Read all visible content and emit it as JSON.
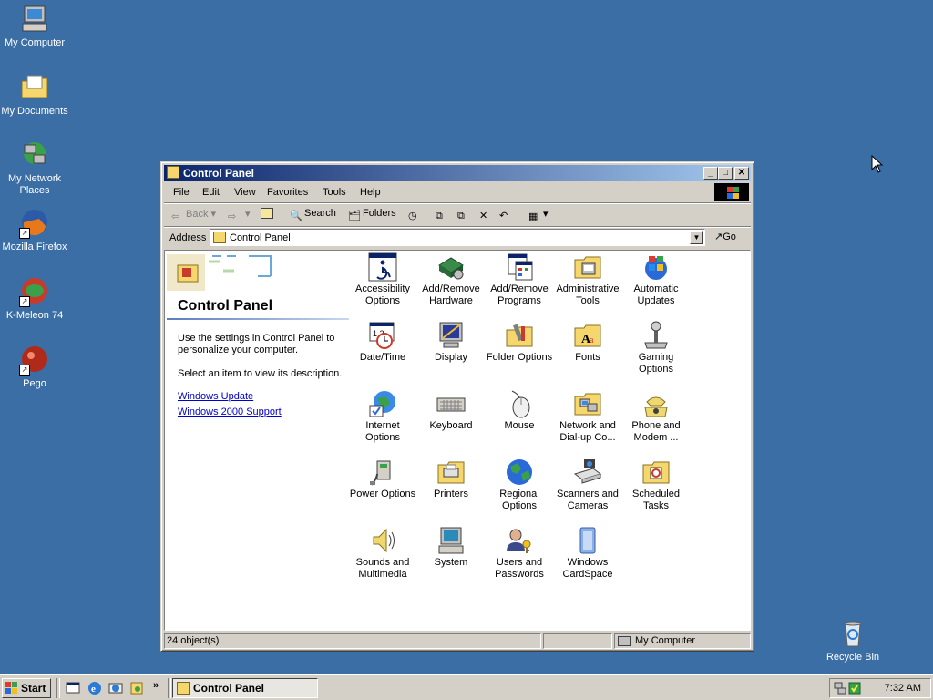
{
  "desktop": {
    "icons": [
      {
        "label": "My Computer",
        "icon": "my-computer-icon"
      },
      {
        "label": "My Documents",
        "icon": "my-documents-icon"
      },
      {
        "label": "My Network Places",
        "icon": "network-places-icon"
      },
      {
        "label": "Mozilla Firefox",
        "icon": "firefox-icon"
      },
      {
        "label": "K-Meleon 74",
        "icon": "k-meleon-icon"
      },
      {
        "label": "Pego",
        "icon": "pego-icon"
      },
      {
        "label": "Recycle Bin",
        "icon": "recycle-bin-icon"
      }
    ],
    "background": "#3a6ea5"
  },
  "window": {
    "title": "Control Panel",
    "menu": [
      "File",
      "Edit",
      "View",
      "Favorites",
      "Tools",
      "Help"
    ],
    "toolbar": {
      "back": "Back",
      "search": "Search",
      "folders": "Folders"
    },
    "address": {
      "label": "Address",
      "value": "Control Panel",
      "go": "Go"
    },
    "sidebar": {
      "title": "Control Panel",
      "description": "Use the settings in Control Panel to personalize your computer.",
      "hint": "Select an item to view its description.",
      "links": [
        "Windows Update",
        "Windows 2000 Support"
      ]
    },
    "items": [
      {
        "label": "Accessibility Options",
        "icon": "accessibility-icon"
      },
      {
        "label": "Add/Remove Hardware",
        "icon": "add-hardware-icon"
      },
      {
        "label": "Add/Remove Programs",
        "icon": "add-programs-icon"
      },
      {
        "label": "Administrative Tools",
        "icon": "admin-tools-icon"
      },
      {
        "label": "Automatic Updates",
        "icon": "windows-update-icon"
      },
      {
        "label": "Date/Time",
        "icon": "date-time-icon"
      },
      {
        "label": "Display",
        "icon": "display-icon"
      },
      {
        "label": "Folder Options",
        "icon": "folder-options-icon"
      },
      {
        "label": "Fonts",
        "icon": "fonts-icon"
      },
      {
        "label": "Gaming Options",
        "icon": "gaming-icon"
      },
      {
        "label": "Internet Options",
        "icon": "internet-options-icon"
      },
      {
        "label": "Keyboard",
        "icon": "keyboard-icon"
      },
      {
        "label": "Mouse",
        "icon": "mouse-icon"
      },
      {
        "label": "Network and Dial-up Co...",
        "icon": "network-icon"
      },
      {
        "label": "Phone and Modem ...",
        "icon": "phone-icon"
      },
      {
        "label": "Power Options",
        "icon": "power-icon"
      },
      {
        "label": "Printers",
        "icon": "printers-icon"
      },
      {
        "label": "Regional Options",
        "icon": "globe-icon"
      },
      {
        "label": "Scanners and Cameras",
        "icon": "scanner-icon"
      },
      {
        "label": "Scheduled Tasks",
        "icon": "scheduled-tasks-icon"
      },
      {
        "label": "Sounds and Multimedia",
        "icon": "sounds-icon"
      },
      {
        "label": "System",
        "icon": "system-icon"
      },
      {
        "label": "Users and Passwords",
        "icon": "users-icon"
      },
      {
        "label": "Windows CardSpace",
        "icon": "cardspace-icon"
      }
    ],
    "status": {
      "count": "24 object(s)",
      "zone": "My Computer"
    }
  },
  "taskbar": {
    "start": "Start",
    "task": "Control Panel",
    "clock": "7:32 AM"
  }
}
